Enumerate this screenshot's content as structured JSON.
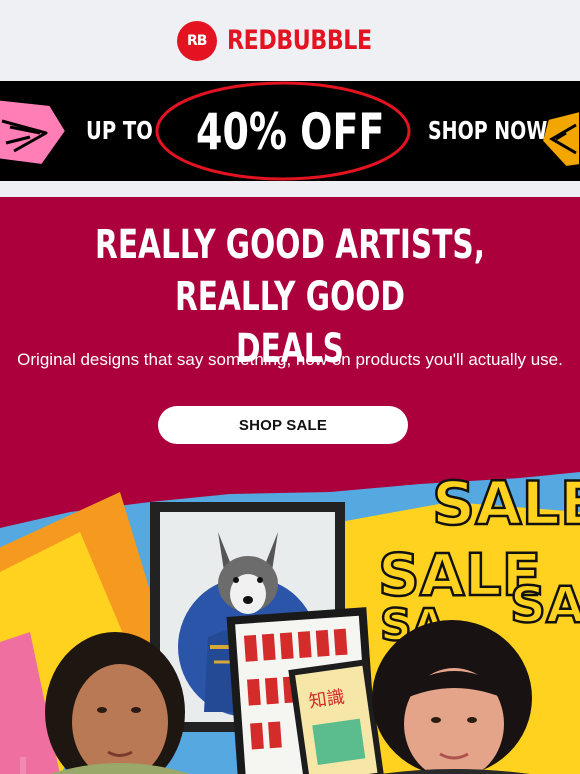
{
  "brand": {
    "logo_mark": "RB",
    "name": "REDBUBBLE"
  },
  "promo": {
    "prefix": "UP TO",
    "offer": "40% OFF",
    "cta": "SHOP NOW"
  },
  "hero": {
    "headline_line1": "REALLY GOOD ARTISTS, REALLY GOOD",
    "headline_line2": "DEALS",
    "subtext": "Original designs that say something, now on products you'll actually use.",
    "button_label": "SHOP SALE",
    "illustration_text": [
      "SALE",
      "SALE",
      "SA",
      "SA"
    ],
    "poster_text": "知識"
  },
  "colors": {
    "brand_red": "#e41321",
    "hero_bg": "#ac003c",
    "promo_bg": "#000000",
    "accent_yellow": "#ffd21f"
  }
}
